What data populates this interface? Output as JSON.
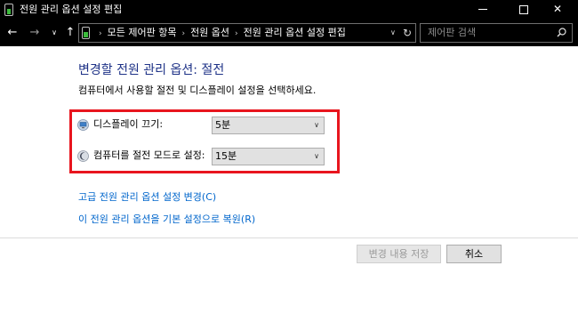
{
  "window": {
    "title": "전원 관리 옵션 설정 편집",
    "minimize_glyph": "minimize-icon",
    "maximize_glyph": "maximize-icon",
    "close_glyph": "✕"
  },
  "nav": {
    "back": "←",
    "forward": "→",
    "recent": "∨",
    "up": "↑",
    "breadcrumbs": [
      "모든 제어판 항목",
      "전원 옵션",
      "전원 관리 옵션 설정 편집"
    ],
    "crumb_separator": "›",
    "lead_separator": "›",
    "dropdown": "∨",
    "refresh": "↻",
    "search_placeholder": "제어판 검색"
  },
  "main": {
    "heading": "변경할 전원 관리 옵션: 절전",
    "subtext": "컴퓨터에서 사용할 절전 및 디스플레이 설정을 선택하세요.",
    "settings": [
      {
        "label": "디스플레이 끄기:",
        "value": "5분",
        "icon": "monitor-icon"
      },
      {
        "label": "컴퓨터를 절전 모드로 설정:",
        "value": "15분",
        "icon": "moon-icon"
      }
    ],
    "select_chevron": "∨",
    "links": {
      "advanced": "고급 전원 관리 옵션 설정 변경(C)",
      "restore": "이 전원 관리 옵션을 기본 설정으로 복원(R)"
    }
  },
  "footer": {
    "save_label": "변경 내용 저장",
    "cancel_label": "취소"
  },
  "colors": {
    "titlebar": "#000000",
    "heading": "#1e3287",
    "link": "#0066cc",
    "highlight": "#e8151e"
  }
}
